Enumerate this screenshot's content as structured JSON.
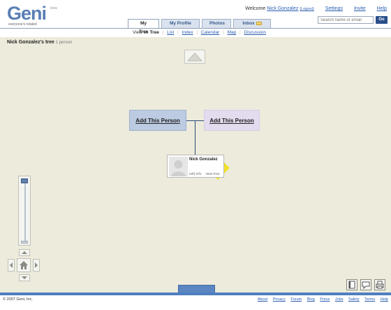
{
  "logo": {
    "name": "Geni",
    "beta": "beta",
    "tagline": "everyone's related"
  },
  "header": {
    "welcome": "Welcome",
    "user_name": "Nick Gonzalez",
    "logout": "(Logout)",
    "settings": "Settings",
    "invite": "Invite",
    "help": "Help"
  },
  "search": {
    "placeholder": "Search name or email",
    "go": "Go"
  },
  "tabs": [
    {
      "label": "My Tree"
    },
    {
      "label": "My Profile"
    },
    {
      "label": "Photos"
    },
    {
      "label": "Inbox"
    }
  ],
  "subnav": {
    "prefix": "View as",
    "current": "Tree",
    "items": [
      "List",
      "Index",
      "Calendar",
      "Map",
      "Discussion"
    ]
  },
  "tree": {
    "title": "Nick Gonzalez's tree",
    "count": "1 person",
    "father_label": "Add This Person",
    "mother_label": "Add This Person",
    "me_name": "Nick Gonzalez",
    "me_edit": "edit info",
    "me_view": "view tree"
  },
  "zoom": {
    "level": 0.05
  },
  "bottom_tab": {
    "label": ""
  },
  "footer": {
    "copyright": "© 2007 Geni, Inc.",
    "links": [
      "About",
      "Privacy",
      "Forum",
      "Blog",
      "Press",
      "Jobs",
      "Safety",
      "Terms",
      "Help"
    ]
  },
  "colors": {
    "canvas": "#ecebdc",
    "father_box": "#bccbe2",
    "mother_box": "#e3dcef",
    "accent": "#4f7fc0",
    "me_marker": "#f2e030"
  }
}
